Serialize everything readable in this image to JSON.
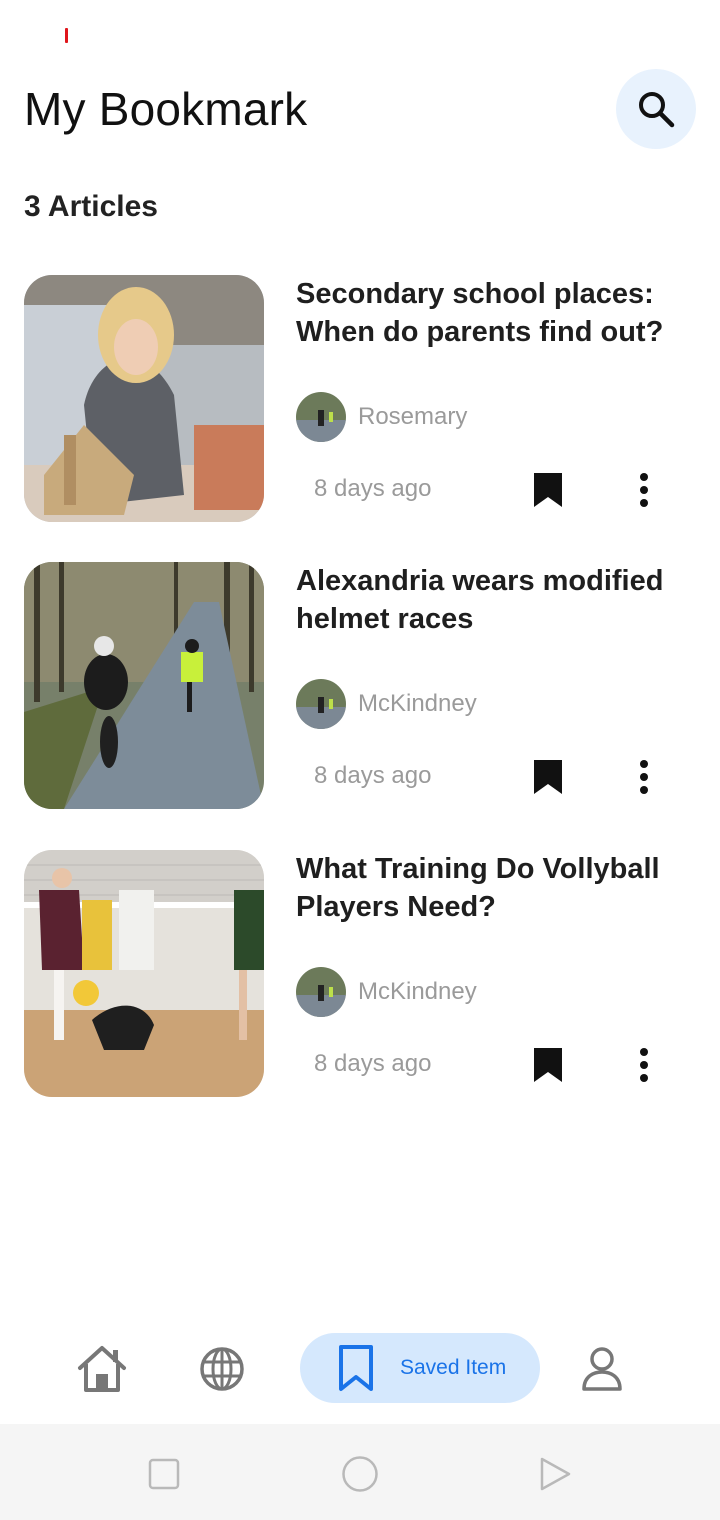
{
  "header": {
    "title": "My Bookmark"
  },
  "summary": {
    "count_label": "3 Articles"
  },
  "articles": [
    {
      "title": "Secondary school places: When do parents find out?",
      "author": "Rosemary",
      "time": "8 days ago",
      "thumb": "girl-building-catapult-photo"
    },
    {
      "title": "Alexandria wears modified helmet races",
      "author": "McKindney",
      "time": "8 days ago",
      "thumb": "cyclists-on-road-photo"
    },
    {
      "title": "What Training Do Vollyball Players Need?",
      "author": "McKindney",
      "time": "8 days ago",
      "thumb": "volleyball-match-photo"
    }
  ],
  "bottom_nav": {
    "items": [
      {
        "icon": "home-icon"
      },
      {
        "icon": "globe-icon"
      },
      {
        "icon": "bookmark-icon",
        "label": "Saved Item",
        "active": true
      },
      {
        "icon": "user-icon"
      }
    ]
  },
  "colors": {
    "accent": "#1a73e8",
    "active_pill": "#d5e8fd",
    "search_bg": "#e8f2fd",
    "muted_text": "#9a9a9a"
  }
}
